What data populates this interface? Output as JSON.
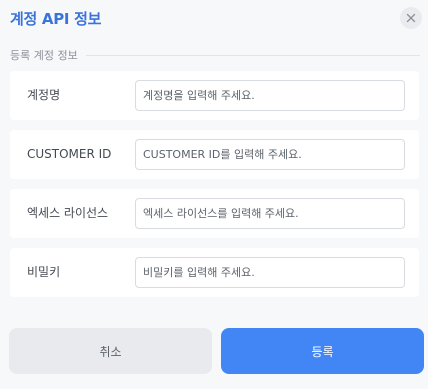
{
  "dialog": {
    "title": "계정 API 정보",
    "close_icon": "close-icon"
  },
  "section": {
    "heading": "등록 계정 정보"
  },
  "fields": [
    {
      "label": "계정명",
      "placeholder": "계정명을 입력해 주세요.",
      "value": ""
    },
    {
      "label": "CUSTOMER ID",
      "placeholder": "CUSTOMER ID를 입력해 주세요.",
      "value": ""
    },
    {
      "label": "엑세스 라이선스",
      "placeholder": "엑세스 라이선스를 입력해 주세요.",
      "value": ""
    },
    {
      "label": "비밀키",
      "placeholder": "비밀키를 입력해 주세요.",
      "value": ""
    }
  ],
  "footer": {
    "cancel_label": "취소",
    "submit_label": "등록"
  },
  "colors": {
    "accent": "#3b74d9",
    "primary_button": "#4285f4",
    "secondary_button": "#e8eaee",
    "background": "#f7f8fa"
  }
}
